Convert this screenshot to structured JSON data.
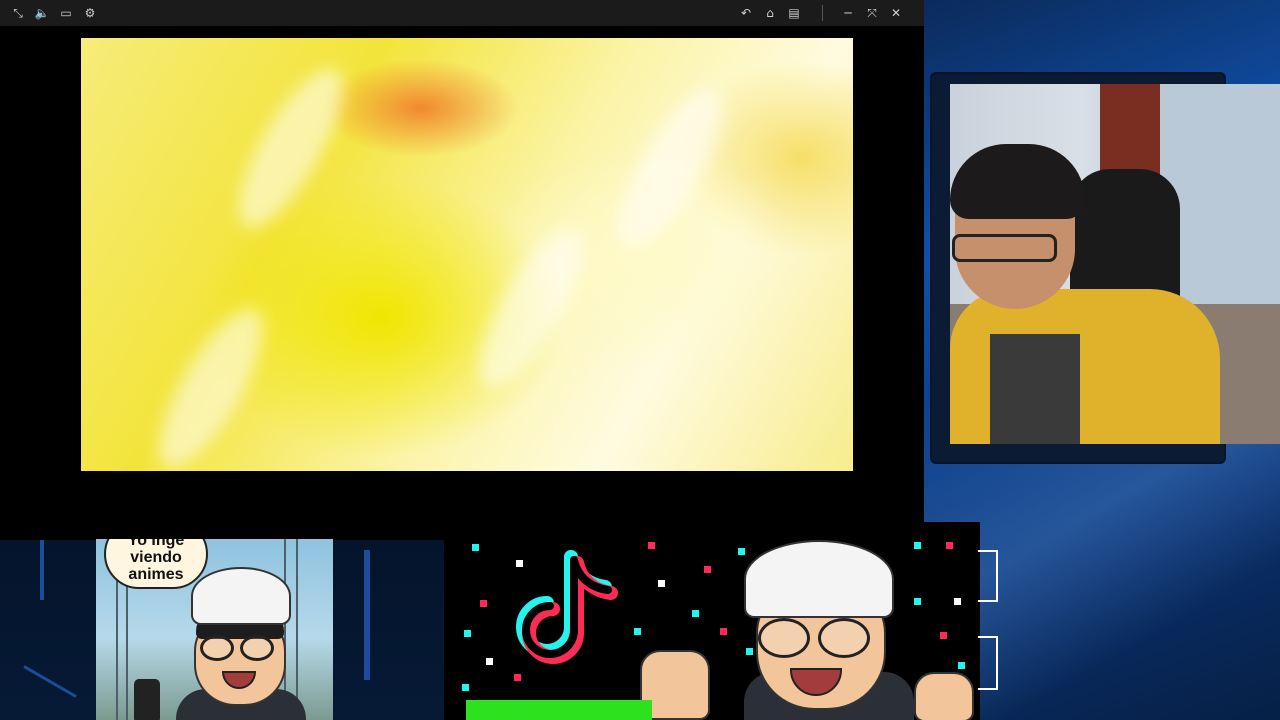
{
  "player": {
    "toolbar_left": [
      {
        "name": "fullscreen-off-icon",
        "glyph": "⤡"
      },
      {
        "name": "volume-icon",
        "glyph": "🔈"
      },
      {
        "name": "subtitles-icon",
        "glyph": "▭"
      },
      {
        "name": "settings-gear-icon",
        "glyph": "⚙"
      }
    ],
    "toolbar_right": [
      {
        "name": "undo-icon",
        "glyph": "↶"
      },
      {
        "name": "home-icon",
        "glyph": "⌂"
      },
      {
        "name": "layout-icon",
        "glyph": "▤"
      },
      {
        "name": "minimize-icon",
        "glyph": "─"
      },
      {
        "name": "restore-icon",
        "glyph": "⤧"
      },
      {
        "name": "close-icon",
        "glyph": "✕"
      }
    ]
  },
  "overlay": {
    "comic_bubble": [
      "Yo Inge",
      "viendo",
      "animes"
    ]
  },
  "colors": {
    "desktop_blue": "#0f4fa8",
    "tiktok_cyan": "#25f4ee",
    "tiktok_red": "#fe2c55",
    "green_bar": "#2de11f"
  }
}
